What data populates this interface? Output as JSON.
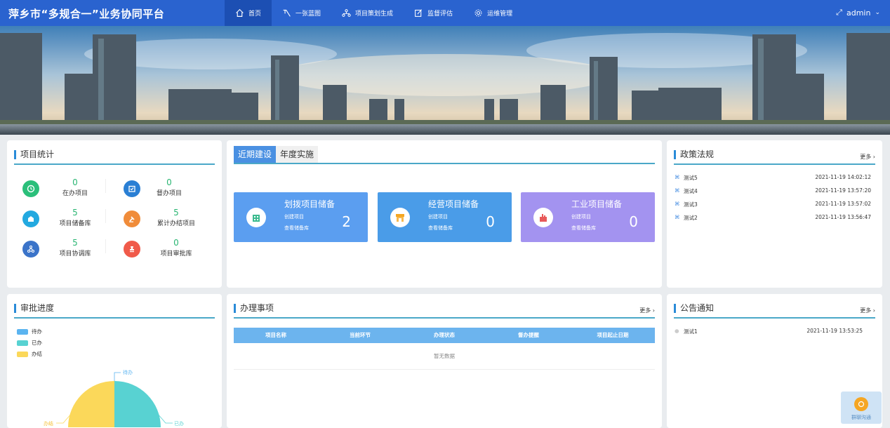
{
  "header": {
    "title": "萍乡市“多规合一”业务协同平台",
    "nav": [
      {
        "label": "首页",
        "icon": "home-icon"
      },
      {
        "label": "一张蓝图",
        "icon": "blueprint-icon"
      },
      {
        "label": "项目策划生成",
        "icon": "org-chart-icon"
      },
      {
        "label": "监督评估",
        "icon": "edit-icon"
      },
      {
        "label": "运维管理",
        "icon": "gear-icon"
      }
    ],
    "user": "admin"
  },
  "stats": {
    "title": "项目统计",
    "items": [
      {
        "value": "0",
        "label": "在办项目",
        "color": "#2bbf7a",
        "icon": "clock-icon"
      },
      {
        "value": "0",
        "label": "督办项目",
        "color": "#2a7fd4",
        "icon": "calendar-check-icon"
      },
      {
        "value": "5",
        "label": "项目储备库",
        "color": "#23a9e0",
        "icon": "box-icon"
      },
      {
        "value": "5",
        "label": "累计办结项目",
        "color": "#f08c3a",
        "icon": "gavel-icon"
      },
      {
        "value": "5",
        "label": "项目协调库",
        "color": "#3b74c9",
        "icon": "network-icon"
      },
      {
        "value": "0",
        "label": "项目审批库",
        "color": "#f05a4a",
        "icon": "stamp-icon"
      }
    ]
  },
  "construction": {
    "tabs": [
      "近期建设",
      "年度实施"
    ],
    "cards": [
      {
        "title": "划拨项目储备",
        "create": "创建项目",
        "view": "查看储备库",
        "count": "2",
        "color": "#5b9ef0",
        "icon": "building-icon"
      },
      {
        "title": "经营项目储备",
        "create": "创建项目",
        "view": "查看储备库",
        "count": "0",
        "color": "#4a9ce8",
        "icon": "shop-icon"
      },
      {
        "title": "工业项目储备",
        "create": "创建项目",
        "view": "查看储备库",
        "count": "0",
        "color": "#a393f0",
        "icon": "factory-icon"
      }
    ]
  },
  "policy": {
    "title": "政策法规",
    "more": "更多",
    "items": [
      {
        "title": "测试5",
        "date": "2021-11-19 14:02:12"
      },
      {
        "title": "测试4",
        "date": "2021-11-19 13:57:20"
      },
      {
        "title": "测试3",
        "date": "2021-11-19 13:57:02"
      },
      {
        "title": "测试2",
        "date": "2021-11-19 13:56:47"
      }
    ]
  },
  "approval": {
    "title": "审批进度",
    "legend": [
      {
        "label": "待办",
        "color": "#5bb4f0"
      },
      {
        "label": "已办",
        "color": "#58d2d2"
      },
      {
        "label": "办结",
        "color": "#fbd85a"
      }
    ],
    "labels": {
      "pending": "待办",
      "done": "已办",
      "finished": "办结"
    }
  },
  "tasks": {
    "title": "办理事项",
    "more": "更多",
    "columns": [
      "项目名称",
      "当前环节",
      "办理状态",
      "督办提醒",
      "项目起止日期"
    ],
    "empty": "暂无数据"
  },
  "notice": {
    "title": "公告通知",
    "more": "更多",
    "items": [
      {
        "title": "测试1",
        "date": "2021-11-19 13:53:25"
      }
    ]
  },
  "float": {
    "label": "群聊沟通"
  }
}
